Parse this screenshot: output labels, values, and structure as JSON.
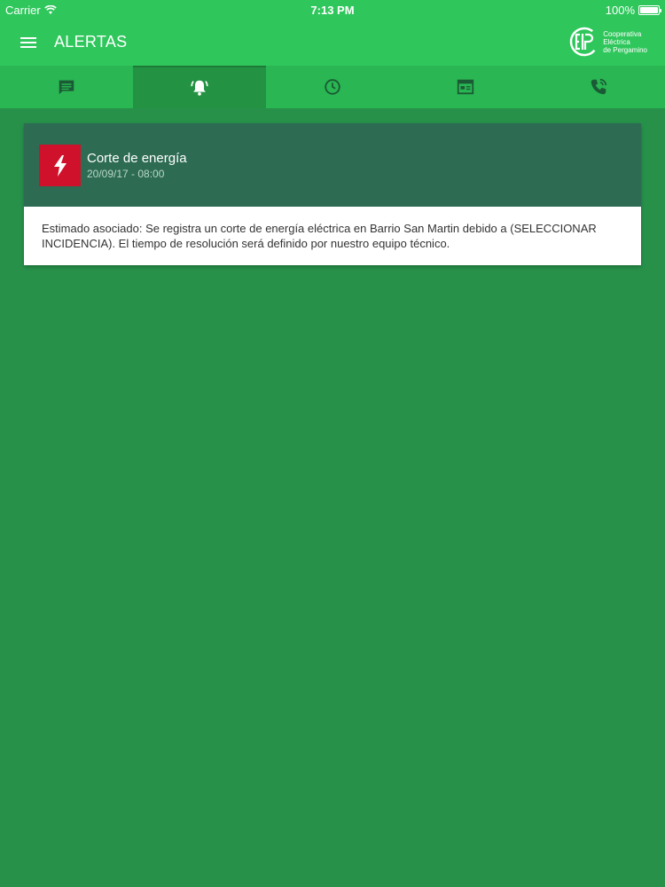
{
  "status_bar": {
    "carrier": "Carrier",
    "time": "7:13 PM",
    "battery": "100%"
  },
  "header": {
    "title": "ALERTAS",
    "logo_lines": [
      "Cooperativa",
      "Eléctrica",
      "de Pergamino"
    ]
  },
  "tabs": [
    {
      "icon": "message-icon",
      "active": false
    },
    {
      "icon": "bell-alert-icon",
      "active": true
    },
    {
      "icon": "clock-icon",
      "active": false
    },
    {
      "icon": "calendar-icon",
      "active": false
    },
    {
      "icon": "phone-icon",
      "active": false
    }
  ],
  "alert": {
    "title": "Corte de energía",
    "date": "20/09/17 - 08:00",
    "icon": "lightning-icon",
    "body": "Estimado asociado: Se registra un corte de energía eléctrica en Barrio San Martin debido a (SELECCIONAR INCIDENCIA). El tiempo de resolución será definido por nuestro equipo técnico."
  },
  "colors": {
    "header": "#2fc75c",
    "background": "#27914a",
    "alert_head": "#2d6c53",
    "alert_icon": "#d0112b"
  }
}
